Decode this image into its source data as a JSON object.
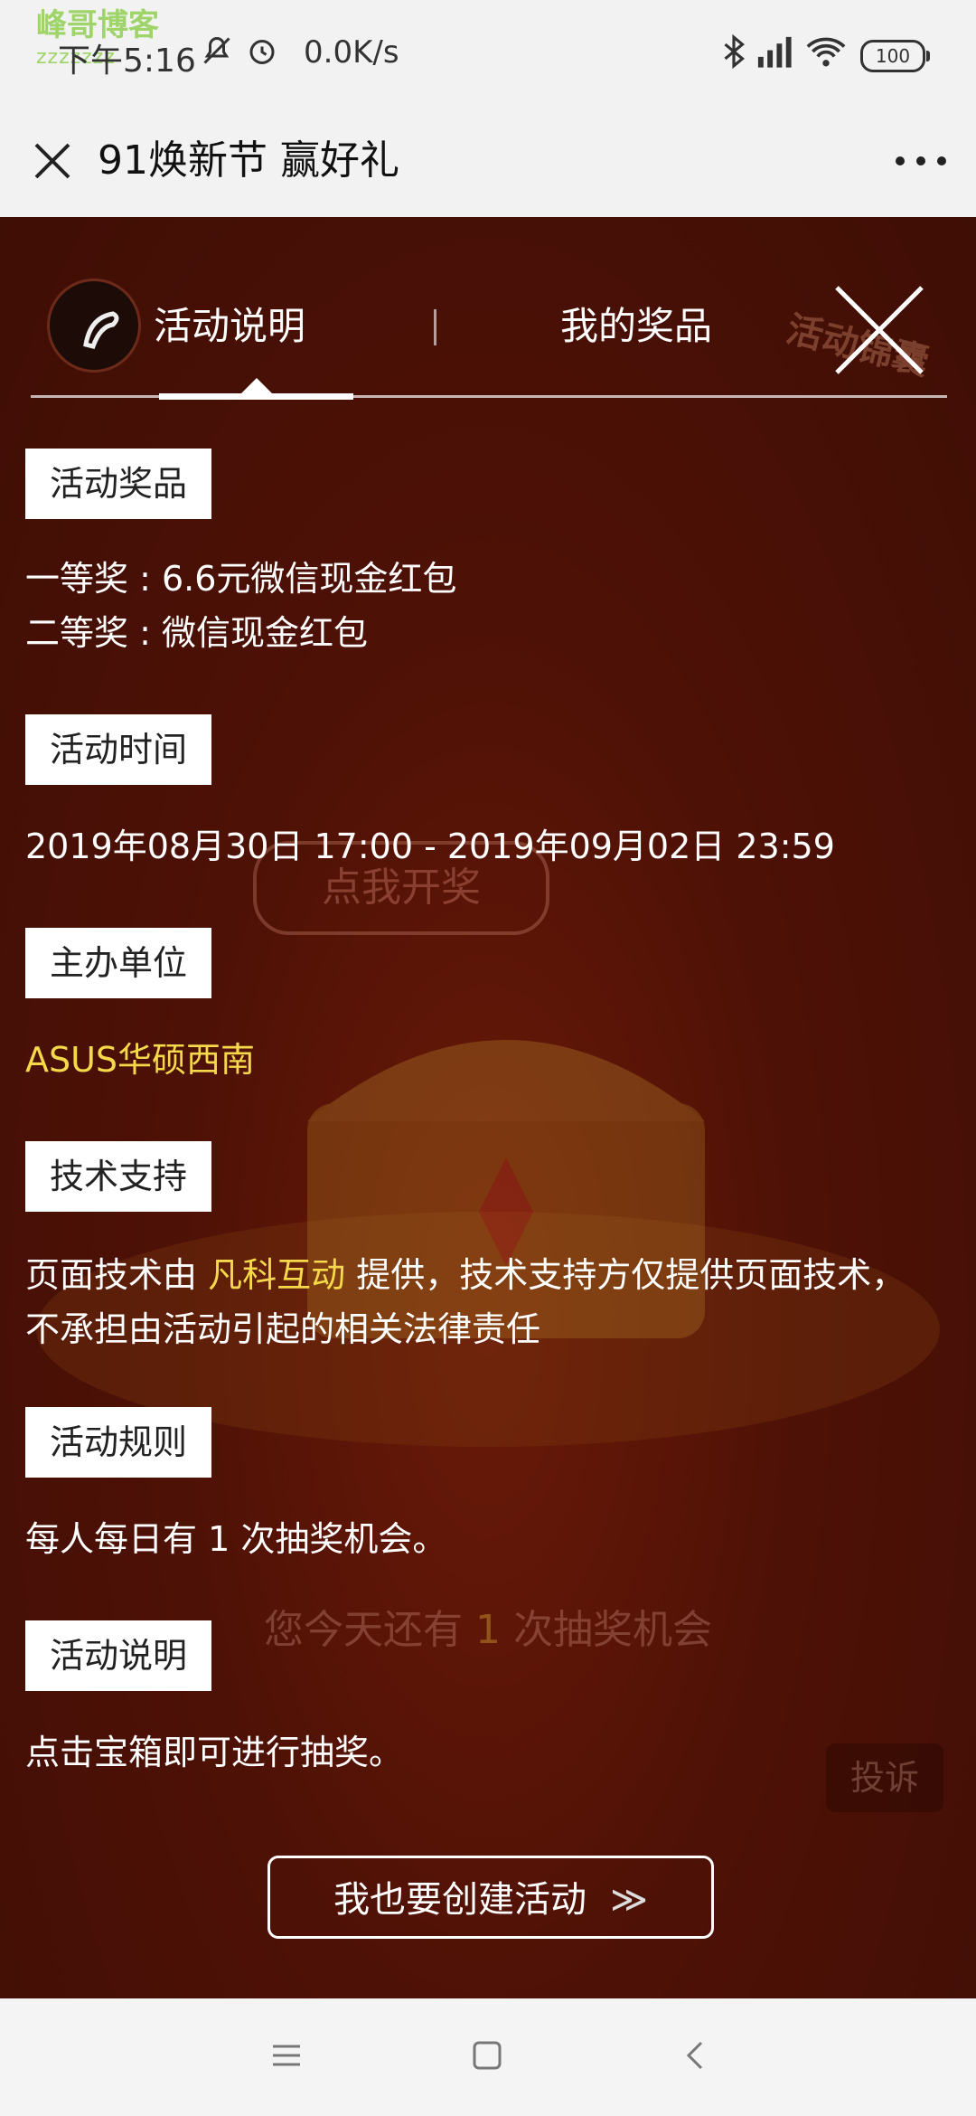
{
  "status_bar": {
    "watermark_title": "峰哥博客",
    "watermark_sub": "zzzzzzz",
    "time": "下午5:16",
    "speed": "0.0K/s",
    "battery": "100"
  },
  "title_bar": {
    "title": "91焕新节 赢好礼"
  },
  "tabs": {
    "activity_desc": "活动说明",
    "my_prizes": "我的奖品"
  },
  "background": {
    "open_prize": "点我开奖",
    "chance_prefix": "您今天还有 ",
    "chance_count": "1",
    "chance_suffix": " 次抽奖机会",
    "report": "投诉",
    "badge": "活动锦囊"
  },
  "sections": {
    "prizes_label": "活动奖品",
    "prize_first": "一等奖 : 6.6元微信现金红包",
    "prize_second": "二等奖 : 微信现金红包",
    "time_label": "活动时间",
    "time_value": "2019年08月30日 17:00 - 2019年09月02日 23:59",
    "organizer_label": "主办单位",
    "organizer_value": "ASUS华硕西南",
    "tech_label": "技术支持",
    "tech_prefix": "页面技术由 ",
    "tech_company": "凡科互动",
    "tech_suffix": " 提供，技术支持方仅提供页面技术，",
    "tech_line2": "不承担由活动引起的相关法律责任",
    "rules_label": "活动规则",
    "rules_value": "每人每日有 1 次抽奖机会。",
    "desc_label": "活动说明",
    "desc_value": "点击宝箱即可进行抽奖。"
  },
  "create_button": {
    "label": "我也要创建活动",
    "arrows": "≫"
  },
  "icons": {
    "close": "close-icon",
    "more": "more-icon",
    "menu": "menu-icon",
    "home": "home-icon",
    "back": "back-icon"
  },
  "colors": {
    "highlight": "#f5d94a",
    "background": "#4e1106"
  }
}
